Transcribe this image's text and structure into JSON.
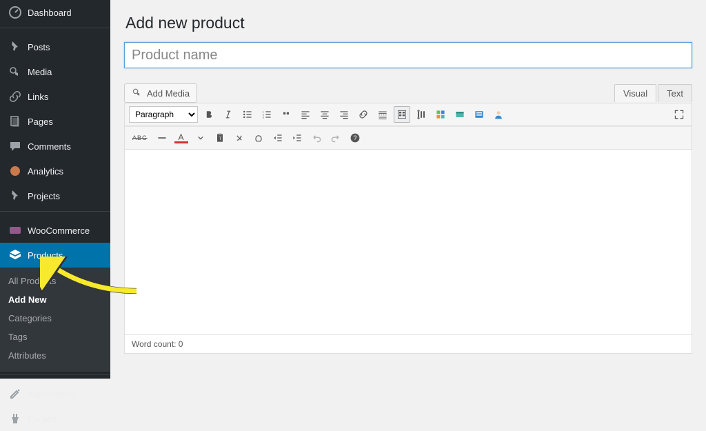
{
  "sidebar": {
    "items": [
      {
        "label": "Dashboard"
      },
      {
        "label": "Posts"
      },
      {
        "label": "Media"
      },
      {
        "label": "Links"
      },
      {
        "label": "Pages"
      },
      {
        "label": "Comments"
      },
      {
        "label": "Analytics"
      },
      {
        "label": "Projects"
      },
      {
        "label": "WooCommerce"
      },
      {
        "label": "Products"
      },
      {
        "label": "Appearance"
      },
      {
        "label": "Plugins"
      }
    ],
    "sub": [
      {
        "label": "All Products"
      },
      {
        "label": "Add New"
      },
      {
        "label": "Categories"
      },
      {
        "label": "Tags"
      },
      {
        "label": "Attributes"
      }
    ]
  },
  "page": {
    "title": "Add new product",
    "title_placeholder": "Product name",
    "add_media": "Add Media",
    "tab_visual": "Visual",
    "tab_text": "Text",
    "paragraph": "Paragraph",
    "wordcount_label": "Word count: 0",
    "abc": "ABC"
  }
}
